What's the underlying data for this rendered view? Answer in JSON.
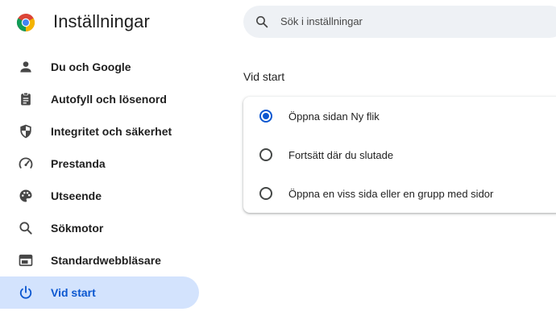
{
  "header": {
    "title": "Inställningar",
    "logo_icon": "chrome-logo-icon"
  },
  "search": {
    "placeholder": "Sök i inställningar",
    "icon": "search-icon"
  },
  "sidebar": {
    "items": [
      {
        "label": "Du och Google",
        "icon": "person-icon",
        "active": false
      },
      {
        "label": "Autofyll och lösenord",
        "icon": "clipboard-icon",
        "active": false
      },
      {
        "label": "Integritet och säkerhet",
        "icon": "shield-icon",
        "active": false
      },
      {
        "label": "Prestanda",
        "icon": "speedometer-icon",
        "active": false
      },
      {
        "label": "Utseende",
        "icon": "palette-icon",
        "active": false
      },
      {
        "label": "Sökmotor",
        "icon": "search-icon",
        "active": false
      },
      {
        "label": "Standardwebbläsare",
        "icon": "browser-icon",
        "active": false
      },
      {
        "label": "Vid start",
        "icon": "power-icon",
        "active": true
      }
    ]
  },
  "main": {
    "section_title": "Vid start",
    "options": [
      {
        "label": "Öppna sidan Ny flik",
        "checked": true
      },
      {
        "label": "Fortsätt där du slutade",
        "checked": false
      },
      {
        "label": "Öppna en viss sida eller en grupp med sidor",
        "checked": false
      }
    ]
  },
  "colors": {
    "accent": "#0b57d0",
    "active_bg": "#d3e3fd",
    "search_bg": "#eef1f5",
    "icon": "#474747"
  }
}
